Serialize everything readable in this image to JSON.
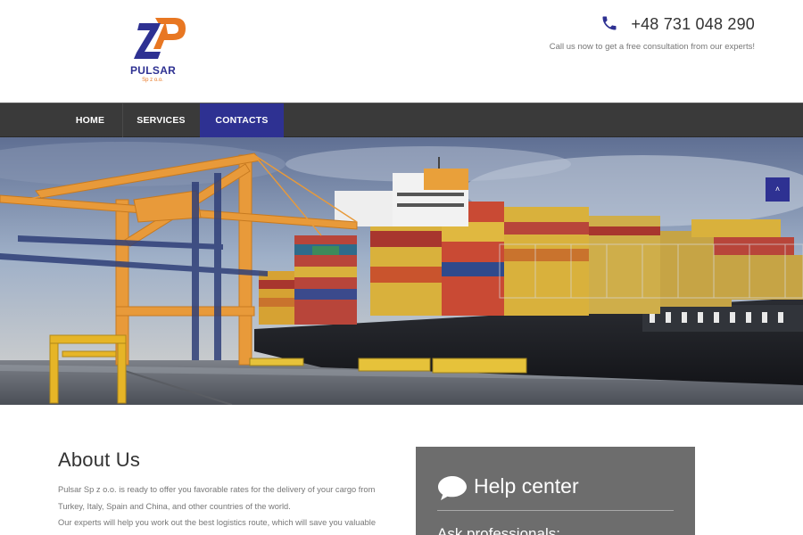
{
  "brand": {
    "name": "PULSAR",
    "sub": "Sp z o.o.",
    "colors": {
      "navy": "#2e3192",
      "orange": "#e87722"
    }
  },
  "contact": {
    "phone": "+48 731 048 290",
    "note": "Call us now to get a free consultation from our experts!",
    "icon": "phone-icon"
  },
  "nav": {
    "items": [
      {
        "label": "HOME",
        "active": false
      },
      {
        "label": "SERVICES",
        "active": false
      },
      {
        "label": "CONTACTS",
        "active": true
      }
    ]
  },
  "hero": {
    "image": "container-ship-port-cranes"
  },
  "scroll_top": {
    "icon": "chevron-up-icon",
    "glyph": "˄"
  },
  "about": {
    "title": "About Us",
    "lines": [
      "Pulsar Sp z o.o. is ready to offer you favorable rates for the delivery of your cargo from",
      "Turkey, Italy, Spain and China, and other countries of the world.",
      "Our experts will help you work out the best logistics route, which will save you valuable"
    ]
  },
  "help_center": {
    "icon": "speech-bubble-icon",
    "title": "Help center",
    "subtitle": "Ask professionals:"
  }
}
